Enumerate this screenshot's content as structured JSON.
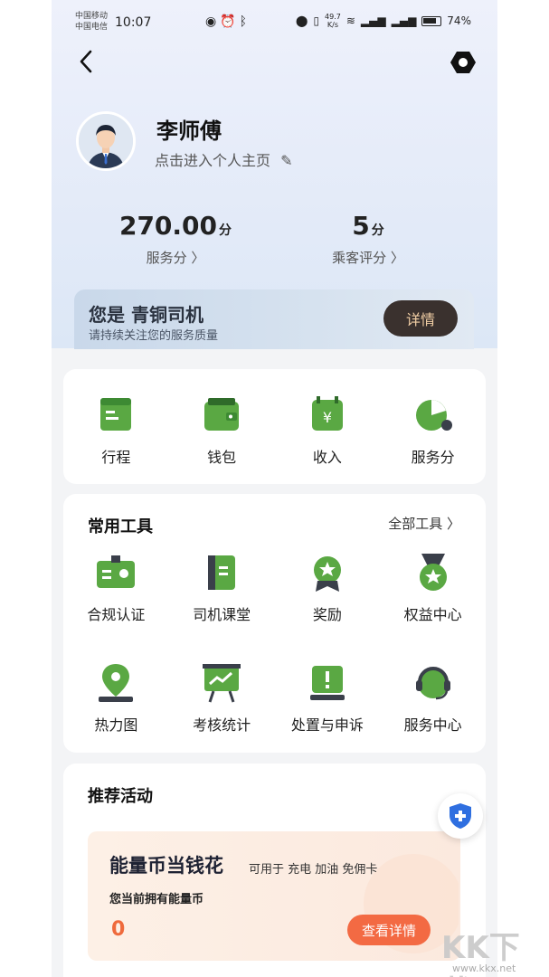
{
  "status_bar": {
    "carrier1": "中国移动",
    "carrier2": "中国电信",
    "time": "10:07",
    "speed_value": "49.7",
    "speed_unit": "K/s",
    "battery": "74%"
  },
  "profile": {
    "name": "李师傅",
    "link": "点击进入个人主页"
  },
  "stats": {
    "service_score": "270.00",
    "service_unit": "分",
    "service_label": "服务分 〉",
    "rating": "5",
    "rating_unit": "分",
    "rating_label": "乘客评分 〉"
  },
  "level": {
    "title": "您是 青铜司机",
    "subtitle": "请持续关注您的服务质量",
    "button": "详情"
  },
  "main_shortcuts": [
    {
      "label": "行程",
      "icon": "itinerary-icon"
    },
    {
      "label": "钱包",
      "icon": "wallet-icon"
    },
    {
      "label": "收入",
      "icon": "income-icon"
    },
    {
      "label": "服务分",
      "icon": "service-score-icon"
    }
  ],
  "tools": {
    "title": "常用工具",
    "all": "全部工具 〉",
    "items": [
      {
        "label": "合规认证",
        "icon": "id-card-icon"
      },
      {
        "label": "司机课堂",
        "icon": "book-icon"
      },
      {
        "label": "奖励",
        "icon": "reward-medal-icon"
      },
      {
        "label": "权益中心",
        "icon": "benefits-medal-icon"
      },
      {
        "label": "热力图",
        "icon": "location-pin-icon"
      },
      {
        "label": "考核统计",
        "icon": "chart-board-icon"
      },
      {
        "label": "处置与申诉",
        "icon": "alert-icon"
      },
      {
        "label": "服务中心",
        "icon": "headset-icon"
      }
    ]
  },
  "activities": {
    "title": "推荐活动",
    "promo_title": "能量币当钱花",
    "promo_tags": "可用于 充电 加油 免佣卡",
    "promo_sub": "您当前拥有能量币",
    "promo_value": "0",
    "promo_button": "查看详情"
  },
  "watermark": {
    "text": "KK下载",
    "url": "www.kkx.net"
  },
  "colors": {
    "accent_green": "#5aa843",
    "promo_orange": "#f36a43",
    "shield_blue": "#2f6fe0"
  }
}
